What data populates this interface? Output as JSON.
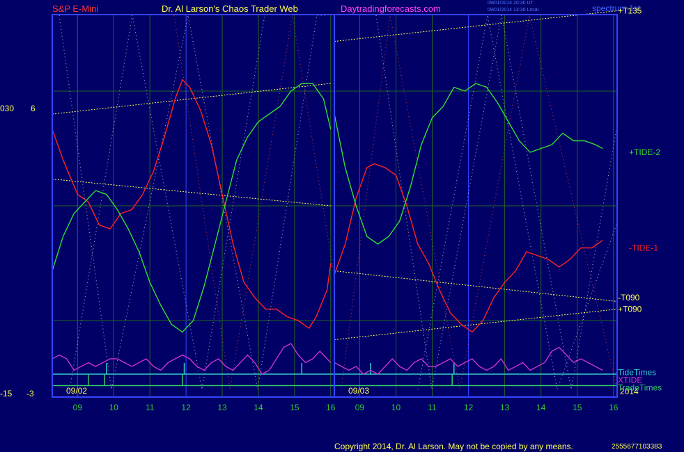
{
  "header": {
    "instrument": "S&P E-Mini",
    "title": "Dr. Al Larson's Chaos Trader Web",
    "site": "Daytradingforecasts.com",
    "timestamp_line1": "09/01/2014 20:30 UT",
    "timestamp_line2": "09/01/2014 13:30 Local",
    "spectrum_label": "spectrum-1st"
  },
  "footer": {
    "copyright": "Copyright 2014, Dr. Al Larson. May not be copied by any means.",
    "code": "2555677103383"
  },
  "colors": {
    "background": "#000066",
    "frame": "#3344ff",
    "grid": "#226622",
    "day_divider": "#3344ff",
    "tide1": "#ff2222",
    "tide2": "#33dd33",
    "xtide": "#cc33cc",
    "tidetimes": "#33cccc",
    "tradetimes": "#33cc66",
    "channel": "#ffff55",
    "axis_text": "#ffff55",
    "hour_text": "#33cc33",
    "dots_white": "#ccccdd",
    "dots_red": "#dd4444"
  },
  "chart_data": {
    "type": "line",
    "left_scale_labels": [
      {
        "text": "030",
        "row": "upper"
      },
      {
        "text": "6",
        "row": "upper"
      },
      {
        "text": "-15",
        "row": "lower"
      },
      {
        "text": "-3",
        "row": "lower"
      }
    ],
    "hours": [
      "09",
      "10",
      "11",
      "12",
      "13",
      "14",
      "15",
      "16",
      "09",
      "10",
      "11",
      "12",
      "13",
      "14",
      "15",
      "16"
    ],
    "dates": [
      "09/02",
      "09/03"
    ],
    "year": "2014",
    "x_range": [
      8.3,
      16.1
    ],
    "y_range": [
      0,
      100
    ],
    "series": [
      {
        "name": "-TIDE-1",
        "key": "tide1",
        "day1": [
          [
            8.3,
            70
          ],
          [
            8.6,
            62
          ],
          [
            9.0,
            53
          ],
          [
            9.3,
            51
          ],
          [
            9.6,
            45
          ],
          [
            9.9,
            44
          ],
          [
            10.2,
            48
          ],
          [
            10.5,
            49
          ],
          [
            10.8,
            53
          ],
          [
            11.1,
            59
          ],
          [
            11.4,
            68
          ],
          [
            11.7,
            78
          ],
          [
            11.9,
            83
          ],
          [
            12.1,
            81
          ],
          [
            12.4,
            75
          ],
          [
            12.7,
            66
          ],
          [
            13.0,
            53
          ],
          [
            13.3,
            40
          ],
          [
            13.6,
            30
          ],
          [
            13.9,
            26
          ],
          [
            14.2,
            23
          ],
          [
            14.5,
            23
          ],
          [
            14.8,
            21
          ],
          [
            15.1,
            20
          ],
          [
            15.4,
            18
          ],
          [
            15.6,
            21
          ],
          [
            15.9,
            28
          ],
          [
            16.0,
            35
          ]
        ],
        "day2": [
          [
            8.3,
            32
          ],
          [
            8.6,
            40
          ],
          [
            8.9,
            52
          ],
          [
            9.2,
            60
          ],
          [
            9.4,
            61
          ],
          [
            9.7,
            60
          ],
          [
            10.0,
            58
          ],
          [
            10.3,
            50
          ],
          [
            10.6,
            40
          ],
          [
            10.9,
            35
          ],
          [
            11.2,
            28
          ],
          [
            11.5,
            22
          ],
          [
            11.8,
            19
          ],
          [
            12.1,
            17
          ],
          [
            12.4,
            20
          ],
          [
            12.7,
            26
          ],
          [
            13.0,
            30
          ],
          [
            13.3,
            33
          ],
          [
            13.6,
            38
          ],
          [
            13.9,
            37
          ],
          [
            14.2,
            36
          ],
          [
            14.5,
            34
          ],
          [
            14.8,
            36
          ],
          [
            15.1,
            39
          ],
          [
            15.4,
            39
          ],
          [
            15.7,
            41
          ]
        ]
      },
      {
        "name": "+TIDE-2",
        "key": "tide2",
        "day1": [
          [
            8.3,
            33
          ],
          [
            8.6,
            42
          ],
          [
            8.9,
            48
          ],
          [
            9.2,
            51
          ],
          [
            9.5,
            54
          ],
          [
            9.8,
            53
          ],
          [
            10.1,
            49
          ],
          [
            10.4,
            44
          ],
          [
            10.7,
            38
          ],
          [
            11.0,
            30
          ],
          [
            11.3,
            24
          ],
          [
            11.6,
            19
          ],
          [
            11.9,
            17
          ],
          [
            12.2,
            20
          ],
          [
            12.5,
            29
          ],
          [
            12.8,
            40
          ],
          [
            13.1,
            51
          ],
          [
            13.4,
            62
          ],
          [
            13.7,
            68
          ],
          [
            14.0,
            72
          ],
          [
            14.3,
            74
          ],
          [
            14.6,
            76
          ],
          [
            14.9,
            80
          ],
          [
            15.2,
            82
          ],
          [
            15.5,
            82
          ],
          [
            15.8,
            78
          ],
          [
            16.0,
            70
          ]
        ],
        "day2": [
          [
            8.3,
            74
          ],
          [
            8.6,
            60
          ],
          [
            8.9,
            50
          ],
          [
            9.2,
            42
          ],
          [
            9.5,
            40
          ],
          [
            9.8,
            42
          ],
          [
            10.1,
            46
          ],
          [
            10.4,
            55
          ],
          [
            10.7,
            66
          ],
          [
            11.0,
            73
          ],
          [
            11.3,
            76
          ],
          [
            11.6,
            81
          ],
          [
            11.9,
            80
          ],
          [
            12.2,
            82
          ],
          [
            12.5,
            81
          ],
          [
            12.8,
            77
          ],
          [
            13.1,
            72
          ],
          [
            13.4,
            67
          ],
          [
            13.7,
            64
          ],
          [
            14.0,
            65
          ],
          [
            14.3,
            66
          ],
          [
            14.6,
            69
          ],
          [
            14.9,
            67
          ],
          [
            15.2,
            67
          ],
          [
            15.5,
            66
          ],
          [
            15.7,
            65
          ]
        ]
      },
      {
        "name": "XTIDE",
        "key": "xtide",
        "day1": [
          [
            8.3,
            10
          ],
          [
            8.5,
            11
          ],
          [
            8.7,
            10
          ],
          [
            8.9,
            7
          ],
          [
            9.1,
            8
          ],
          [
            9.3,
            9
          ],
          [
            9.5,
            8
          ],
          [
            9.7,
            9
          ],
          [
            9.9,
            10
          ],
          [
            10.1,
            10
          ],
          [
            10.3,
            9
          ],
          [
            10.5,
            8
          ],
          [
            10.7,
            9
          ],
          [
            10.9,
            10
          ],
          [
            11.1,
            8
          ],
          [
            11.3,
            7
          ],
          [
            11.5,
            9
          ],
          [
            11.7,
            10
          ],
          [
            11.9,
            11
          ],
          [
            12.1,
            10
          ],
          [
            12.3,
            8
          ],
          [
            12.5,
            7
          ],
          [
            12.7,
            9
          ],
          [
            12.9,
            10
          ],
          [
            13.1,
            8
          ],
          [
            13.3,
            7
          ],
          [
            13.5,
            9
          ],
          [
            13.7,
            11
          ],
          [
            13.9,
            9
          ],
          [
            14.1,
            6
          ],
          [
            14.3,
            7
          ],
          [
            14.5,
            10
          ],
          [
            14.7,
            13
          ],
          [
            14.9,
            14
          ],
          [
            15.1,
            11
          ],
          [
            15.3,
            9
          ],
          [
            15.5,
            10
          ],
          [
            15.7,
            12
          ],
          [
            15.9,
            10
          ],
          [
            16.0,
            9
          ]
        ],
        "day2": [
          [
            8.3,
            9
          ],
          [
            8.5,
            8
          ],
          [
            8.7,
            7
          ],
          [
            8.9,
            8
          ],
          [
            9.1,
            6
          ],
          [
            9.3,
            7
          ],
          [
            9.5,
            6
          ],
          [
            9.7,
            8
          ],
          [
            9.9,
            10
          ],
          [
            10.1,
            8
          ],
          [
            10.3,
            7
          ],
          [
            10.5,
            9
          ],
          [
            10.7,
            10
          ],
          [
            10.9,
            8
          ],
          [
            11.1,
            8
          ],
          [
            11.3,
            9
          ],
          [
            11.5,
            10
          ],
          [
            11.7,
            8
          ],
          [
            11.9,
            9
          ],
          [
            12.1,
            10
          ],
          [
            12.3,
            8
          ],
          [
            12.5,
            7
          ],
          [
            12.7,
            8
          ],
          [
            12.9,
            10
          ],
          [
            13.1,
            7
          ],
          [
            13.3,
            8
          ],
          [
            13.5,
            9
          ],
          [
            13.7,
            7
          ],
          [
            13.9,
            8
          ],
          [
            14.1,
            9
          ],
          [
            14.3,
            12
          ],
          [
            14.5,
            13
          ],
          [
            14.7,
            11
          ],
          [
            14.9,
            9
          ],
          [
            15.1,
            10
          ],
          [
            15.3,
            9
          ],
          [
            15.5,
            8
          ],
          [
            15.7,
            7
          ]
        ]
      }
    ],
    "tide_times": {
      "name": "TideTimes",
      "key": "tidetimes",
      "y": 6,
      "spikes": [
        9.8,
        11.95,
        15.2,
        9.3,
        11.6
      ]
    },
    "trade_times": {
      "name": "TradeTimes",
      "key": "tradetimes",
      "y": 3,
      "spikes": [
        9.75,
        11.9,
        9.3,
        11.55
      ]
    },
    "channel_lines": [
      {
        "name": "+T135",
        "pts": [
          [
            8.3,
            74
          ],
          [
            16.0,
            82
          ]
        ],
        "day": 1
      },
      {
        "name": "",
        "pts": [
          [
            8.3,
            57
          ],
          [
            16.0,
            50
          ]
        ],
        "day": 1
      },
      {
        "name": "+T135",
        "pts": [
          [
            8.3,
            93
          ],
          [
            16.1,
            101
          ]
        ],
        "day": 2
      },
      {
        "name": "-T090",
        "pts": [
          [
            8.3,
            33
          ],
          [
            16.1,
            25
          ]
        ],
        "day": 2
      },
      {
        "name": "+T090",
        "pts": [
          [
            8.3,
            15
          ],
          [
            16.1,
            23
          ]
        ],
        "day": 2
      }
    ],
    "right_labels": [
      {
        "text": "+T135",
        "key": "channel",
        "y": 101
      },
      {
        "text": "+TIDE-2",
        "key": "tide2",
        "y": 64
      },
      {
        "text": "-TIDE-1",
        "key": "tide1",
        "y": 39
      },
      {
        "text": "-T090",
        "key": "channel",
        "y": 26
      },
      {
        "text": "+T090",
        "key": "channel",
        "y": 23
      },
      {
        "text": "TideTimes",
        "key": "tidetimes",
        "y": 6.5
      },
      {
        "text": "XTIDE",
        "key": "xtide",
        "y": 4.5
      },
      {
        "text": "TradeTimes",
        "key": "tradetimes",
        "y": 2.5
      }
    ],
    "grid": true
  }
}
